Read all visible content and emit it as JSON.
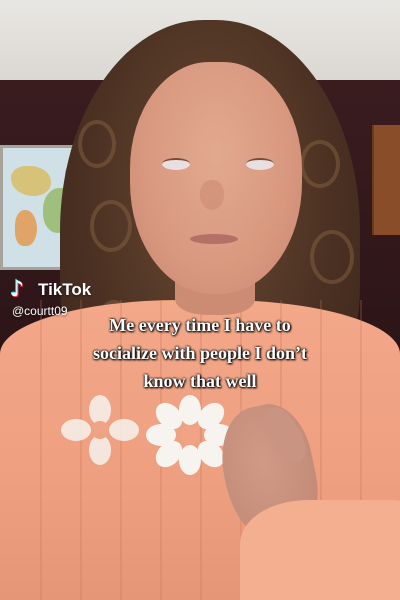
{
  "overlay": {
    "logo_text": "TikTok",
    "username": "@courtt09"
  },
  "caption": {
    "lines": [
      "Me every time I have to",
      "socialize with people I don’t",
      "know that well"
    ]
  },
  "colors": {
    "caption_text": "#ffffff",
    "tiktok_cyan": "#25f4ee",
    "tiktok_red": "#fe2c55",
    "sweater": "#f3a889",
    "wall": "#3a1c1f"
  },
  "icons": {
    "logo": "tiktok-note-icon"
  }
}
